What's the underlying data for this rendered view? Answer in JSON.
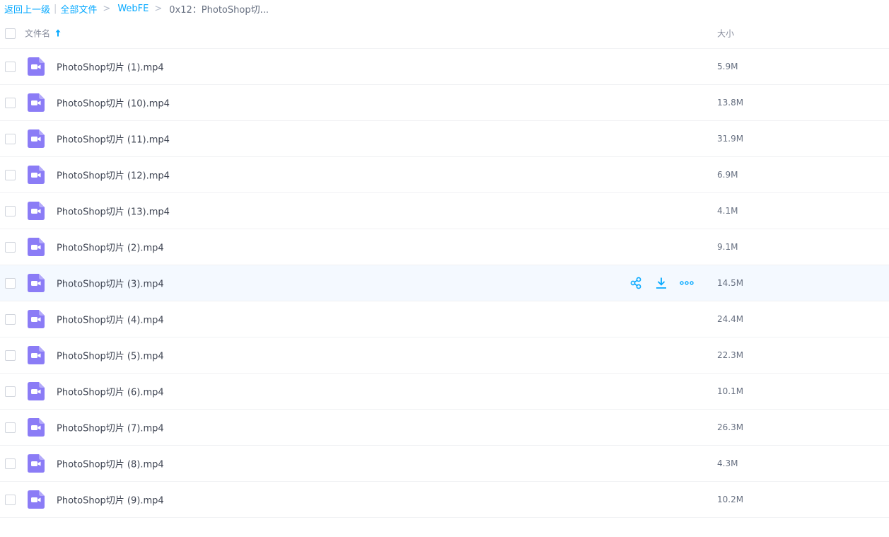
{
  "breadcrumb": {
    "back": "返回上一级",
    "divider": "|",
    "all_files": "全部文件",
    "separator": ">",
    "folder": "WebFE",
    "current": "0x12：PhotoShop切..."
  },
  "columns": {
    "name": "文件名",
    "size": "大小",
    "sort_icon": "arrow-up-icon"
  },
  "files": [
    {
      "name": "PhotoShop切片 (1).mp4",
      "size": "5.9M"
    },
    {
      "name": "PhotoShop切片 (10).mp4",
      "size": "13.8M"
    },
    {
      "name": "PhotoShop切片 (11).mp4",
      "size": "31.9M"
    },
    {
      "name": "PhotoShop切片 (12).mp4",
      "size": "6.9M"
    },
    {
      "name": "PhotoShop切片 (13).mp4",
      "size": "4.1M"
    },
    {
      "name": "PhotoShop切片 (2).mp4",
      "size": "9.1M"
    },
    {
      "name": "PhotoShop切片 (3).mp4",
      "size": "14.5M"
    },
    {
      "name": "PhotoShop切片 (4).mp4",
      "size": "24.4M"
    },
    {
      "name": "PhotoShop切片 (5).mp4",
      "size": "22.3M"
    },
    {
      "name": "PhotoShop切片 (6).mp4",
      "size": "10.1M"
    },
    {
      "name": "PhotoShop切片 (7).mp4",
      "size": "26.3M"
    },
    {
      "name": "PhotoShop切片 (8).mp4",
      "size": "4.3M"
    },
    {
      "name": "PhotoShop切片 (9).mp4",
      "size": "10.2M"
    }
  ],
  "hovered_row_index": 6,
  "row_actions": [
    "share-icon",
    "download-icon",
    "more-icon"
  ],
  "file_icon": "video-file-icon",
  "colors": {
    "accent": "#09aaff",
    "video_icon": "#8b7cf6",
    "hover_row": "#f4f9ff"
  }
}
